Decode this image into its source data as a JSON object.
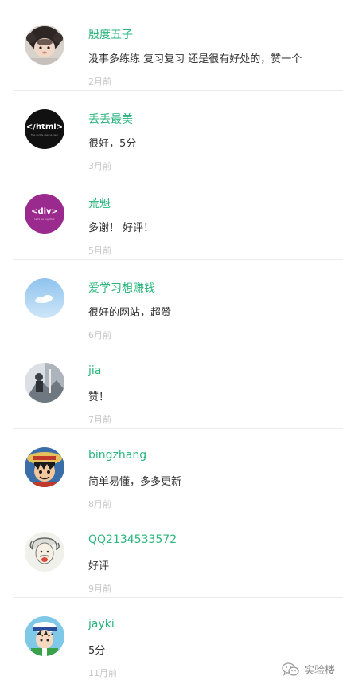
{
  "comments": [
    {
      "username": "殷度五子",
      "content": "没事多练练 复习复习 还是很有好处的，赞一个",
      "time": "2月前",
      "avatar": "monkey-hat-baby-avatar"
    },
    {
      "username": "丢丢最美",
      "content": "很好，5分",
      "time": "3月前",
      "avatar": "html-logo-avatar",
      "avatar_text": "</html>",
      "avatar_subtext": "The end is always near"
    },
    {
      "username": "荒魁",
      "content": "多谢！ 好评！",
      "time": "5月前",
      "avatar": "div-logo-avatar",
      "avatar_text": "<div>",
      "avatar_subtext": "Let's be together"
    },
    {
      "username": "爱学习想赚钱",
      "content": "很好的网站，超赞",
      "time": "6月前",
      "avatar": "sky-cloud-avatar"
    },
    {
      "username": "jia",
      "content": "赞！",
      "time": "7月前",
      "avatar": "photo-avatar"
    },
    {
      "username": "bingzhang",
      "content": "简单易懂，多多更新",
      "time": "8月前",
      "avatar": "luffy-avatar"
    },
    {
      "username": "QQ2134533572",
      "content": "好评",
      "time": "9月前",
      "avatar": "einstein-avatar"
    },
    {
      "username": "jayki",
      "content": "5分",
      "time": "11月前",
      "avatar": "anime-boy-avatar"
    }
  ],
  "watermark": {
    "label": "实验楼",
    "icon": "wechat-icon"
  },
  "colors": {
    "username": "#2ab57d",
    "content": "#333333",
    "time": "#c6c6c6",
    "separator": "#ececec"
  }
}
